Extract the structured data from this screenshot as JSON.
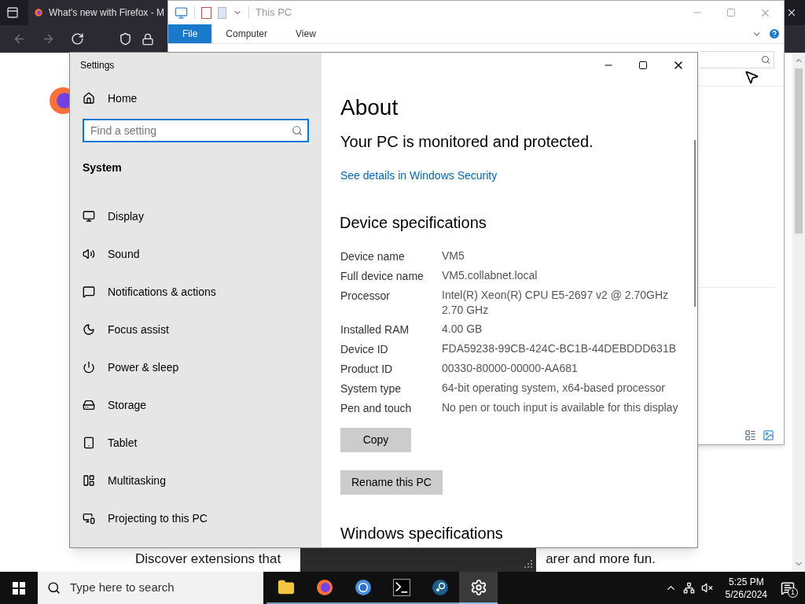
{
  "browser": {
    "tab_title": "What's new with Firefox - M",
    "content_texts": [
      "Discover extensions that",
      "arer and more fun."
    ]
  },
  "explorer": {
    "title": "This PC",
    "ribbon_tabs": [
      {
        "label": "File",
        "selected": true
      },
      {
        "label": "Computer",
        "selected": false
      },
      {
        "label": "View",
        "selected": false
      }
    ]
  },
  "settings": {
    "title": "Settings",
    "home": "Home",
    "search": {
      "placeholder": "Find a setting"
    },
    "section": "System",
    "nav_items": [
      {
        "kind": "display",
        "label": "Display"
      },
      {
        "kind": "sound",
        "label": "Sound"
      },
      {
        "kind": "notifications",
        "label": "Notifications & actions"
      },
      {
        "kind": "focus",
        "label": "Focus assist"
      },
      {
        "kind": "power",
        "label": "Power & sleep"
      },
      {
        "kind": "storage",
        "label": "Storage"
      },
      {
        "kind": "tablet",
        "label": "Tablet"
      },
      {
        "kind": "multitasking",
        "label": "Multitasking"
      },
      {
        "kind": "projecting",
        "label": "Projecting to this PC"
      }
    ],
    "heading": "About",
    "status": "Your PC is monitored and protected.",
    "link": "See details in Windows Security",
    "specs_heading": "Device specifications",
    "specs": [
      {
        "label": "Device name",
        "lines": [
          "VM5"
        ]
      },
      {
        "label": "Full device name",
        "lines": [
          "VM5.collabnet.local"
        ]
      },
      {
        "label": "Processor",
        "lines": [
          "Intel(R) Xeon(R) CPU E5-2697 v2 @ 2.70GHz",
          "2.70 GHz"
        ]
      },
      {
        "label": "Installed RAM",
        "lines": [
          "4.00 GB"
        ]
      },
      {
        "label": "Device ID",
        "lines": [
          "FDA59238-99CB-424C-BC1B-44DEBDDD631B"
        ]
      },
      {
        "label": "Product ID",
        "lines": [
          "00330-80000-00000-AA681"
        ]
      },
      {
        "label": "System type",
        "lines": [
          "64-bit operating system, x64-based processor"
        ]
      },
      {
        "label": "Pen and touch",
        "lines": [
          "No pen or touch input is available for this display"
        ]
      }
    ],
    "buttons": [
      "Copy",
      "Rename this PC"
    ],
    "windows_specs_heading": "Windows specifications"
  },
  "taskbar": {
    "search_placeholder": "Type here to search",
    "apps": [
      {
        "kind": "explorer",
        "selected": false
      },
      {
        "kind": "firefox",
        "selected": false
      },
      {
        "kind": "chrome",
        "selected": false
      },
      {
        "kind": "terminal",
        "selected": false
      },
      {
        "kind": "steam",
        "selected": false
      },
      {
        "kind": "settings",
        "selected": true
      }
    ],
    "time": "5:25 PM",
    "date": "5/26/2024",
    "notification_count": "1"
  }
}
